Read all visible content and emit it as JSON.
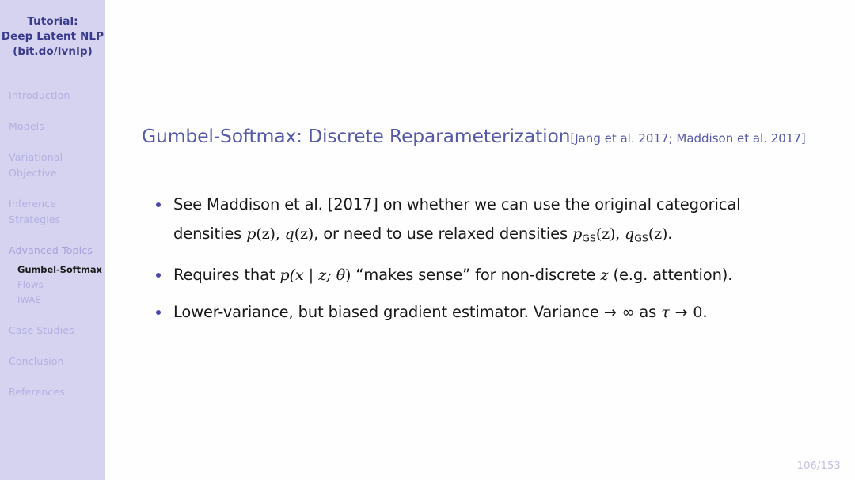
{
  "sidebar": {
    "title_lines": [
      "Tutorial:",
      "Deep Latent NLP",
      "(bit.do/lvnlp)"
    ],
    "sections": [
      {
        "label": "Introduction",
        "sub": []
      },
      {
        "label": "Models",
        "sub": []
      },
      {
        "label": "Variational Objective",
        "sub": []
      },
      {
        "label": "Inference Strategies",
        "sub": []
      },
      {
        "label": "Advanced Topics",
        "sub": [
          {
            "label": "Gumbel-Softmax",
            "active": true
          },
          {
            "label": "Flows",
            "active": false
          },
          {
            "label": "IWAE",
            "active": false
          }
        ]
      },
      {
        "label": "Case Studies",
        "sub": []
      },
      {
        "label": "Conclusion",
        "sub": []
      },
      {
        "label": "References",
        "sub": []
      }
    ]
  },
  "slide": {
    "title": "Gumbel-Softmax: Discrete Reparameterization",
    "title_citation": "[Jang et al. 2017; Maddison et al. 2017]",
    "bullets": [
      {
        "line1_pre": "See Maddison et al. [2017] on whether we can use the original categorical",
        "line2_pre": "densities ",
        "math_p1": "p",
        "math_p1_arg": "(z)",
        "comma1": ", ",
        "math_q1": "q",
        "math_q1_arg": "(z)",
        "line2_mid": ", or need to use relaxed densities ",
        "math_pgs": "p",
        "math_pgs_sub": "GS",
        "math_pgs_arg": "(z)",
        "comma2": ", ",
        "math_qgs": "q",
        "math_qgs_sub": "GS",
        "math_qgs_arg": "(z)",
        "line2_end": "."
      },
      {
        "pre": "Requires that ",
        "math_px": "p(x | z; ",
        "math_theta": "θ",
        "math_px_end": ")",
        "mid": " “makes sense” for non-discrete ",
        "math_z": "z",
        "end": " (e.g. attention)."
      },
      {
        "pre": "Lower-variance, but biased gradient estimator. Variance ",
        "arrow1": "→",
        "infinity": "∞",
        "mid": " as ",
        "tau": "τ",
        "arrow2": "→",
        "zero": "0",
        "end": "."
      }
    ]
  },
  "footer": {
    "page": "106/153"
  },
  "colors": {
    "sidebar_bg": "#d5d3f0",
    "sidebar_title": "#3a3a8c",
    "sidebar_item": "#b3b0e0",
    "sidebar_active": "#1b1b1b",
    "title_accent": "#565aa8",
    "bullet_dot": "#4a47a8",
    "page_num": "#c3c0e4",
    "body_text": "#181818"
  }
}
